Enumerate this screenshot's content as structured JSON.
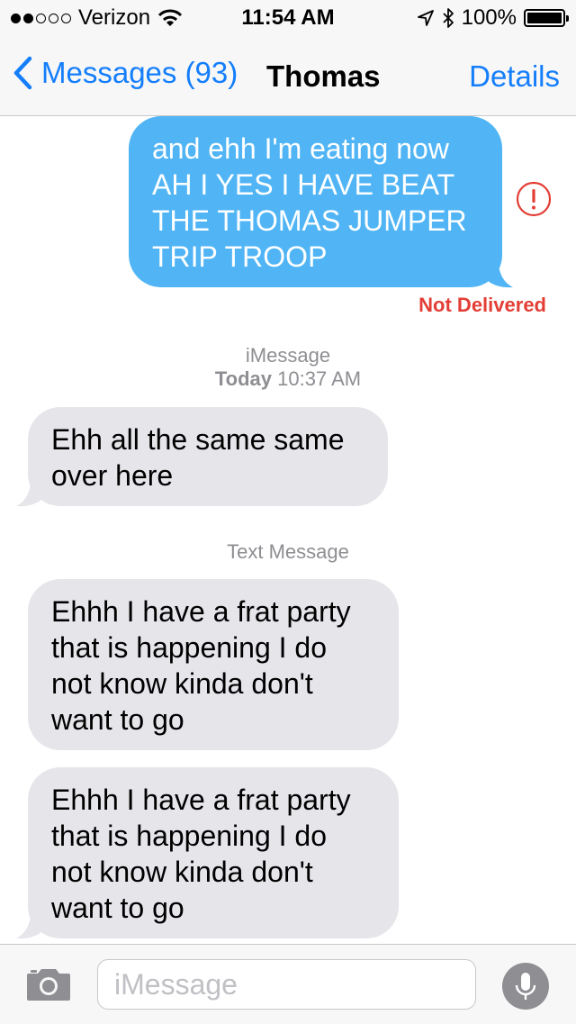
{
  "status_bar": {
    "carrier": "Verizon",
    "time": "11:54 AM",
    "battery": "100%",
    "battery_level": 1.0,
    "signal_bars": 2
  },
  "nav": {
    "back_label": "Messages (93)",
    "title": "Thomas",
    "details_label": "Details"
  },
  "messages": [
    {
      "direction": "outgoing",
      "lines": [
        "and ehh I'm eating now",
        "AH I YES I HAVE BEAT",
        "THE THOMAS JUMPER",
        "TRIP TROOP"
      ],
      "status": "Not Delivered"
    },
    {
      "direction": "incoming",
      "lines": [
        "Ehh all the same same",
        "over here"
      ]
    },
    {
      "direction": "incoming",
      "lines": [
        "Ehhh I have a frat party",
        "that is happening I do",
        "not know kinda don't",
        "want to go"
      ]
    },
    {
      "direction": "incoming",
      "lines": [
        "Ehhh I have a frat party",
        "that is happening I do",
        "not know kinda don't",
        "want to go"
      ]
    }
  ],
  "separators": {
    "imessage_service": "iMessage",
    "imessage_day": "Today",
    "imessage_time": "10:37 AM",
    "text_message": "Text Message"
  },
  "input": {
    "placeholder": "iMessage"
  },
  "colors": {
    "accent": "#147efb",
    "outgoing_bubble": "#51b5f5",
    "incoming_bubble": "#e5e5ea",
    "error": "#e33e36"
  },
  "icons": {
    "signal": "signal-dots-icon",
    "wifi": "wifi-icon",
    "location": "location-arrow-icon",
    "bluetooth": "bluetooth-icon",
    "battery": "battery-icon",
    "back": "chevron-left-icon",
    "error": "exclamation-circle-icon",
    "camera": "camera-icon",
    "mic": "microphone-icon"
  }
}
